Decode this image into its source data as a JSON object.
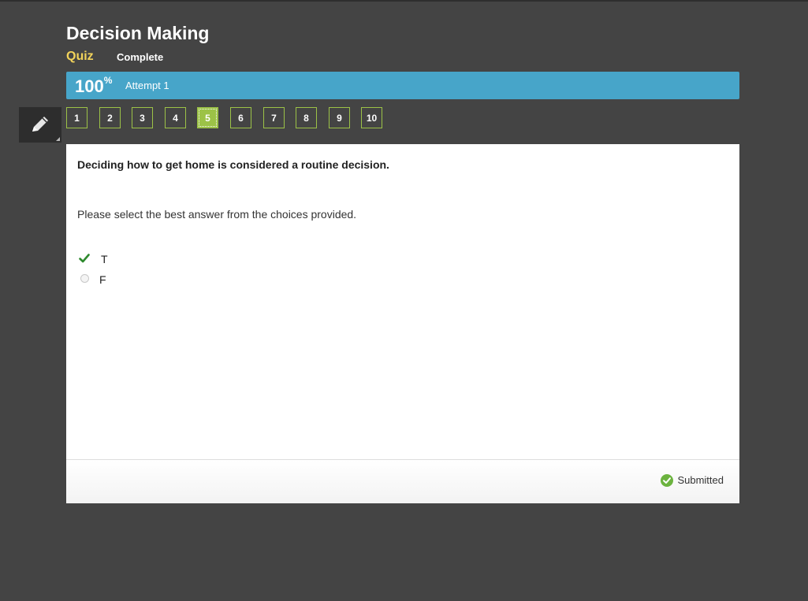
{
  "header": {
    "title": "Decision Making",
    "activity_type": "Quiz",
    "status": "Complete"
  },
  "progress": {
    "score_value": "100",
    "score_unit": "%",
    "attempt": "Attempt 1",
    "percent": 100
  },
  "tools": {
    "pencil_icon": "pencil-icon"
  },
  "question_nav": {
    "items": [
      "1",
      "2",
      "3",
      "4",
      "5",
      "6",
      "7",
      "8",
      "9",
      "10"
    ],
    "current": "5"
  },
  "question": {
    "prompt": "Deciding how to get home is considered a routine decision.",
    "instructions": "Please select the best answer from the choices provided.",
    "choices": [
      {
        "label": "T",
        "selected": true,
        "icon": "checkmark-icon"
      },
      {
        "label": "F",
        "selected": false,
        "icon": "radio-icon"
      }
    ]
  },
  "footer": {
    "status_text": "Submitted",
    "status_icon": "check-circle-icon"
  },
  "colors": {
    "background": "#444444",
    "progress_bar": "#47a5c9",
    "accent_green": "#9cc247",
    "quiz_label": "#f2d35a"
  }
}
